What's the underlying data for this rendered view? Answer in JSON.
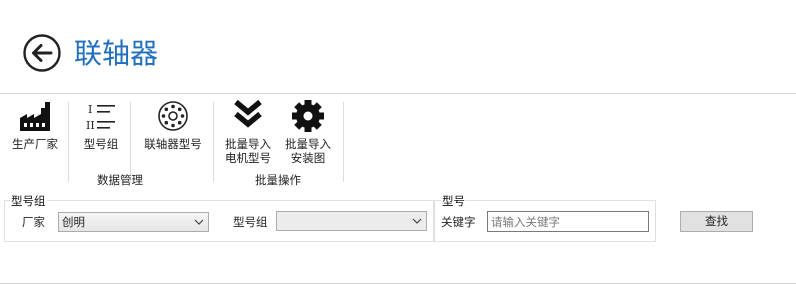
{
  "header": {
    "title": "联轴器"
  },
  "ribbon": {
    "groups": [
      {
        "label": "数据管理"
      },
      {
        "label": "批量操作"
      }
    ],
    "buttons": [
      {
        "label": "生产厂家",
        "icon": "factory-icon"
      },
      {
        "label": "型号组",
        "icon": "list-icon"
      },
      {
        "label": "联轴器型号",
        "icon": "coupling-icon"
      },
      {
        "label_line1": "批量导入",
        "label_line2": "电机型号",
        "icon": "double-chevron-down-icon"
      },
      {
        "label_line1": "批量导入",
        "label_line2": "安装图",
        "icon": "gear-icon"
      }
    ]
  },
  "filters": {
    "group_panel": {
      "legend": "型号组",
      "manufacturer_label": "厂家",
      "manufacturer_value": "创明",
      "model_group_label": "型号组",
      "model_group_value": ""
    },
    "model_panel": {
      "legend": "型号",
      "keyword_label": "关键字",
      "keyword_value": "",
      "keyword_placeholder": "请输入关键字"
    },
    "search_label": "查找"
  },
  "colors": {
    "accent": "#1f6fbf"
  }
}
